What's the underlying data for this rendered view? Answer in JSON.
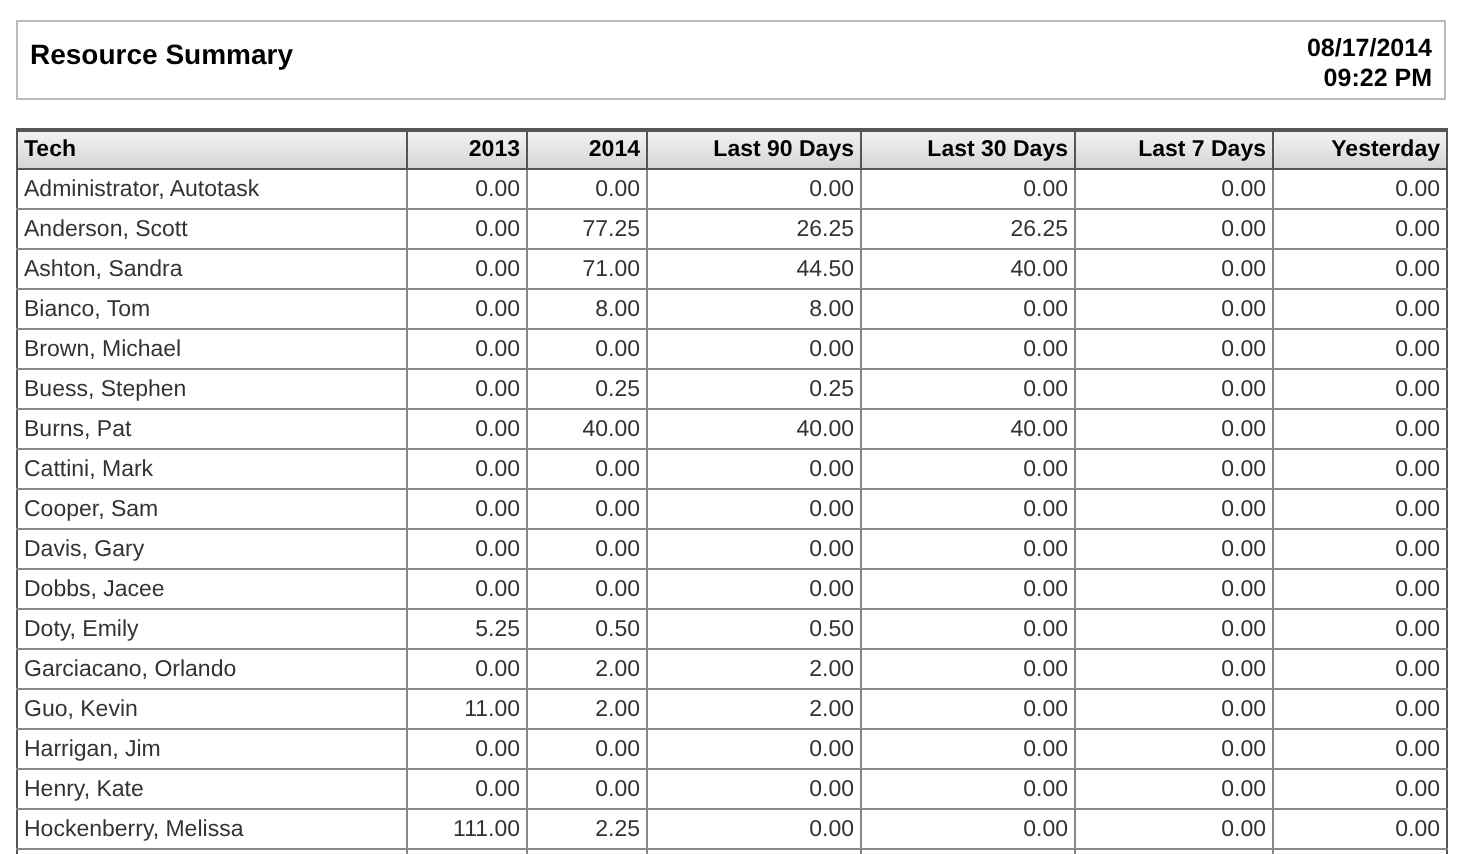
{
  "report": {
    "title": "Resource Summary",
    "date": "08/17/2014",
    "time": "09:22 PM"
  },
  "table": {
    "columns": [
      "Tech",
      "2013",
      "2014",
      "Last 90 Days",
      "Last 30 Days",
      "Last 7 Days",
      "Yesterday"
    ],
    "rows": [
      [
        "Administrator, Autotask",
        "0.00",
        "0.00",
        "0.00",
        "0.00",
        "0.00",
        "0.00"
      ],
      [
        "Anderson, Scott",
        "0.00",
        "77.25",
        "26.25",
        "26.25",
        "0.00",
        "0.00"
      ],
      [
        "Ashton, Sandra",
        "0.00",
        "71.00",
        "44.50",
        "40.00",
        "0.00",
        "0.00"
      ],
      [
        "Bianco, Tom",
        "0.00",
        "8.00",
        "8.00",
        "0.00",
        "0.00",
        "0.00"
      ],
      [
        "Brown, Michael",
        "0.00",
        "0.00",
        "0.00",
        "0.00",
        "0.00",
        "0.00"
      ],
      [
        "Buess, Stephen",
        "0.00",
        "0.25",
        "0.25",
        "0.00",
        "0.00",
        "0.00"
      ],
      [
        "Burns, Pat",
        "0.00",
        "40.00",
        "40.00",
        "40.00",
        "0.00",
        "0.00"
      ],
      [
        "Cattini, Mark",
        "0.00",
        "0.00",
        "0.00",
        "0.00",
        "0.00",
        "0.00"
      ],
      [
        "Cooper, Sam",
        "0.00",
        "0.00",
        "0.00",
        "0.00",
        "0.00",
        "0.00"
      ],
      [
        "Davis, Gary",
        "0.00",
        "0.00",
        "0.00",
        "0.00",
        "0.00",
        "0.00"
      ],
      [
        "Dobbs, Jacee",
        "0.00",
        "0.00",
        "0.00",
        "0.00",
        "0.00",
        "0.00"
      ],
      [
        "Doty, Emily",
        "5.25",
        "0.50",
        "0.50",
        "0.00",
        "0.00",
        "0.00"
      ],
      [
        "Garciacano, Orlando",
        "0.00",
        "2.00",
        "2.00",
        "0.00",
        "0.00",
        "0.00"
      ],
      [
        "Guo, Kevin",
        "11.00",
        "2.00",
        "2.00",
        "0.00",
        "0.00",
        "0.00"
      ],
      [
        "Harrigan, Jim",
        "0.00",
        "0.00",
        "0.00",
        "0.00",
        "0.00",
        "0.00"
      ],
      [
        "Henry, Kate",
        "0.00",
        "0.00",
        "0.00",
        "0.00",
        "0.00",
        "0.00"
      ],
      [
        "Hockenberry, Melissa",
        "111.00",
        "2.25",
        "0.00",
        "0.00",
        "0.00",
        "0.00"
      ]
    ]
  }
}
